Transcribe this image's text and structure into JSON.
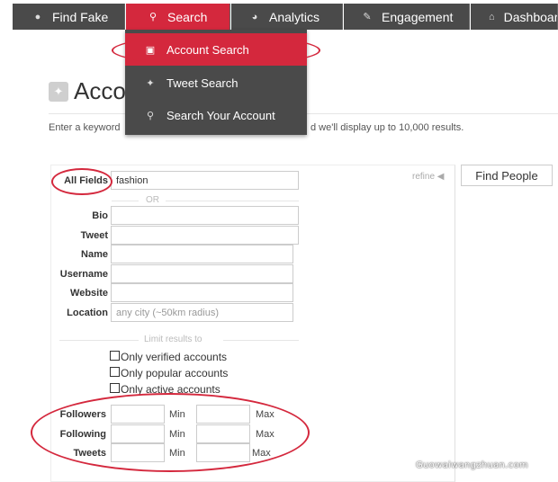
{
  "nav": {
    "items": [
      {
        "label": "Find Fake",
        "icon": "user-icon"
      },
      {
        "label": "Search",
        "icon": "search-icon",
        "active": true
      },
      {
        "label": "Analytics",
        "icon": "dashboard-icon"
      },
      {
        "label": "Engagement",
        "icon": "edit-icon"
      },
      {
        "label": "Dashboard",
        "icon": "home-icon"
      }
    ],
    "dropdown": [
      {
        "label": "Account Search",
        "icon": "checkbox-icon",
        "active": true
      },
      {
        "label": "Tweet Search",
        "icon": "twitter-bird-icon"
      },
      {
        "label": "Search Your Account",
        "icon": "search-icon"
      }
    ]
  },
  "page": {
    "title": "Acco",
    "intro_left": "Enter a keyword",
    "intro_right": "d we'll display up to 10,000 results."
  },
  "form": {
    "all_fields_label": "All Fields",
    "all_fields_value": "fashion",
    "or_label": "OR",
    "refine_label": "refine ◀",
    "find_button": "Find People",
    "fields": [
      {
        "label": "Bio",
        "value": ""
      },
      {
        "label": "Tweet",
        "value": ""
      },
      {
        "label": "Name",
        "value": ""
      },
      {
        "label": "Username",
        "value": ""
      },
      {
        "label": "Website",
        "value": ""
      },
      {
        "label": "Location",
        "value": "",
        "placeholder": "any city (~50km radius)"
      }
    ],
    "limit_label": "Limit results to",
    "checkboxes": [
      "Only verified accounts",
      "Only popular accounts",
      "Only active accounts"
    ],
    "ranges": [
      {
        "label": "Followers",
        "min_label": "Min",
        "max_label": "Max"
      },
      {
        "label": "Following",
        "min_label": "Min",
        "max_label": "Max"
      },
      {
        "label": "Tweets",
        "min_label": "Min",
        "max_label": "Max"
      }
    ]
  },
  "watermark": "Guowaiwangzhuan.com",
  "colors": {
    "accent": "#d4283d",
    "nav_bg": "#4a4a4a"
  }
}
